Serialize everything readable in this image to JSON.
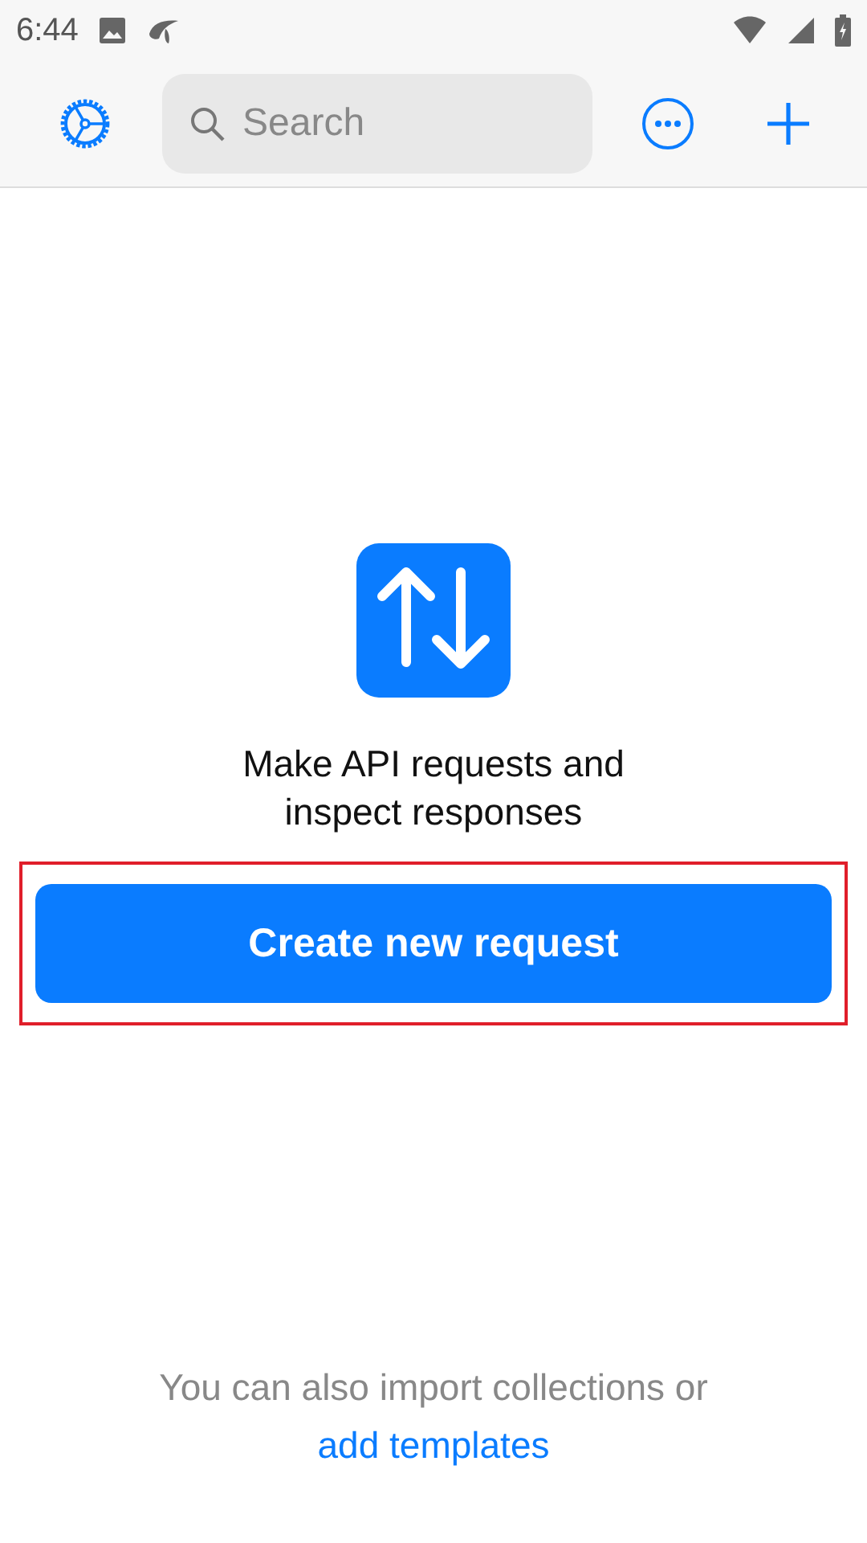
{
  "status_bar": {
    "time": "6:44"
  },
  "toolbar": {
    "search": {
      "placeholder": "Search"
    }
  },
  "empty_state": {
    "message": "Make API requests and inspect responses",
    "button": {
      "label": "Create new request",
      "highlighted": true
    }
  },
  "footer": {
    "text": "You can also import collections or",
    "link": "add templates"
  }
}
